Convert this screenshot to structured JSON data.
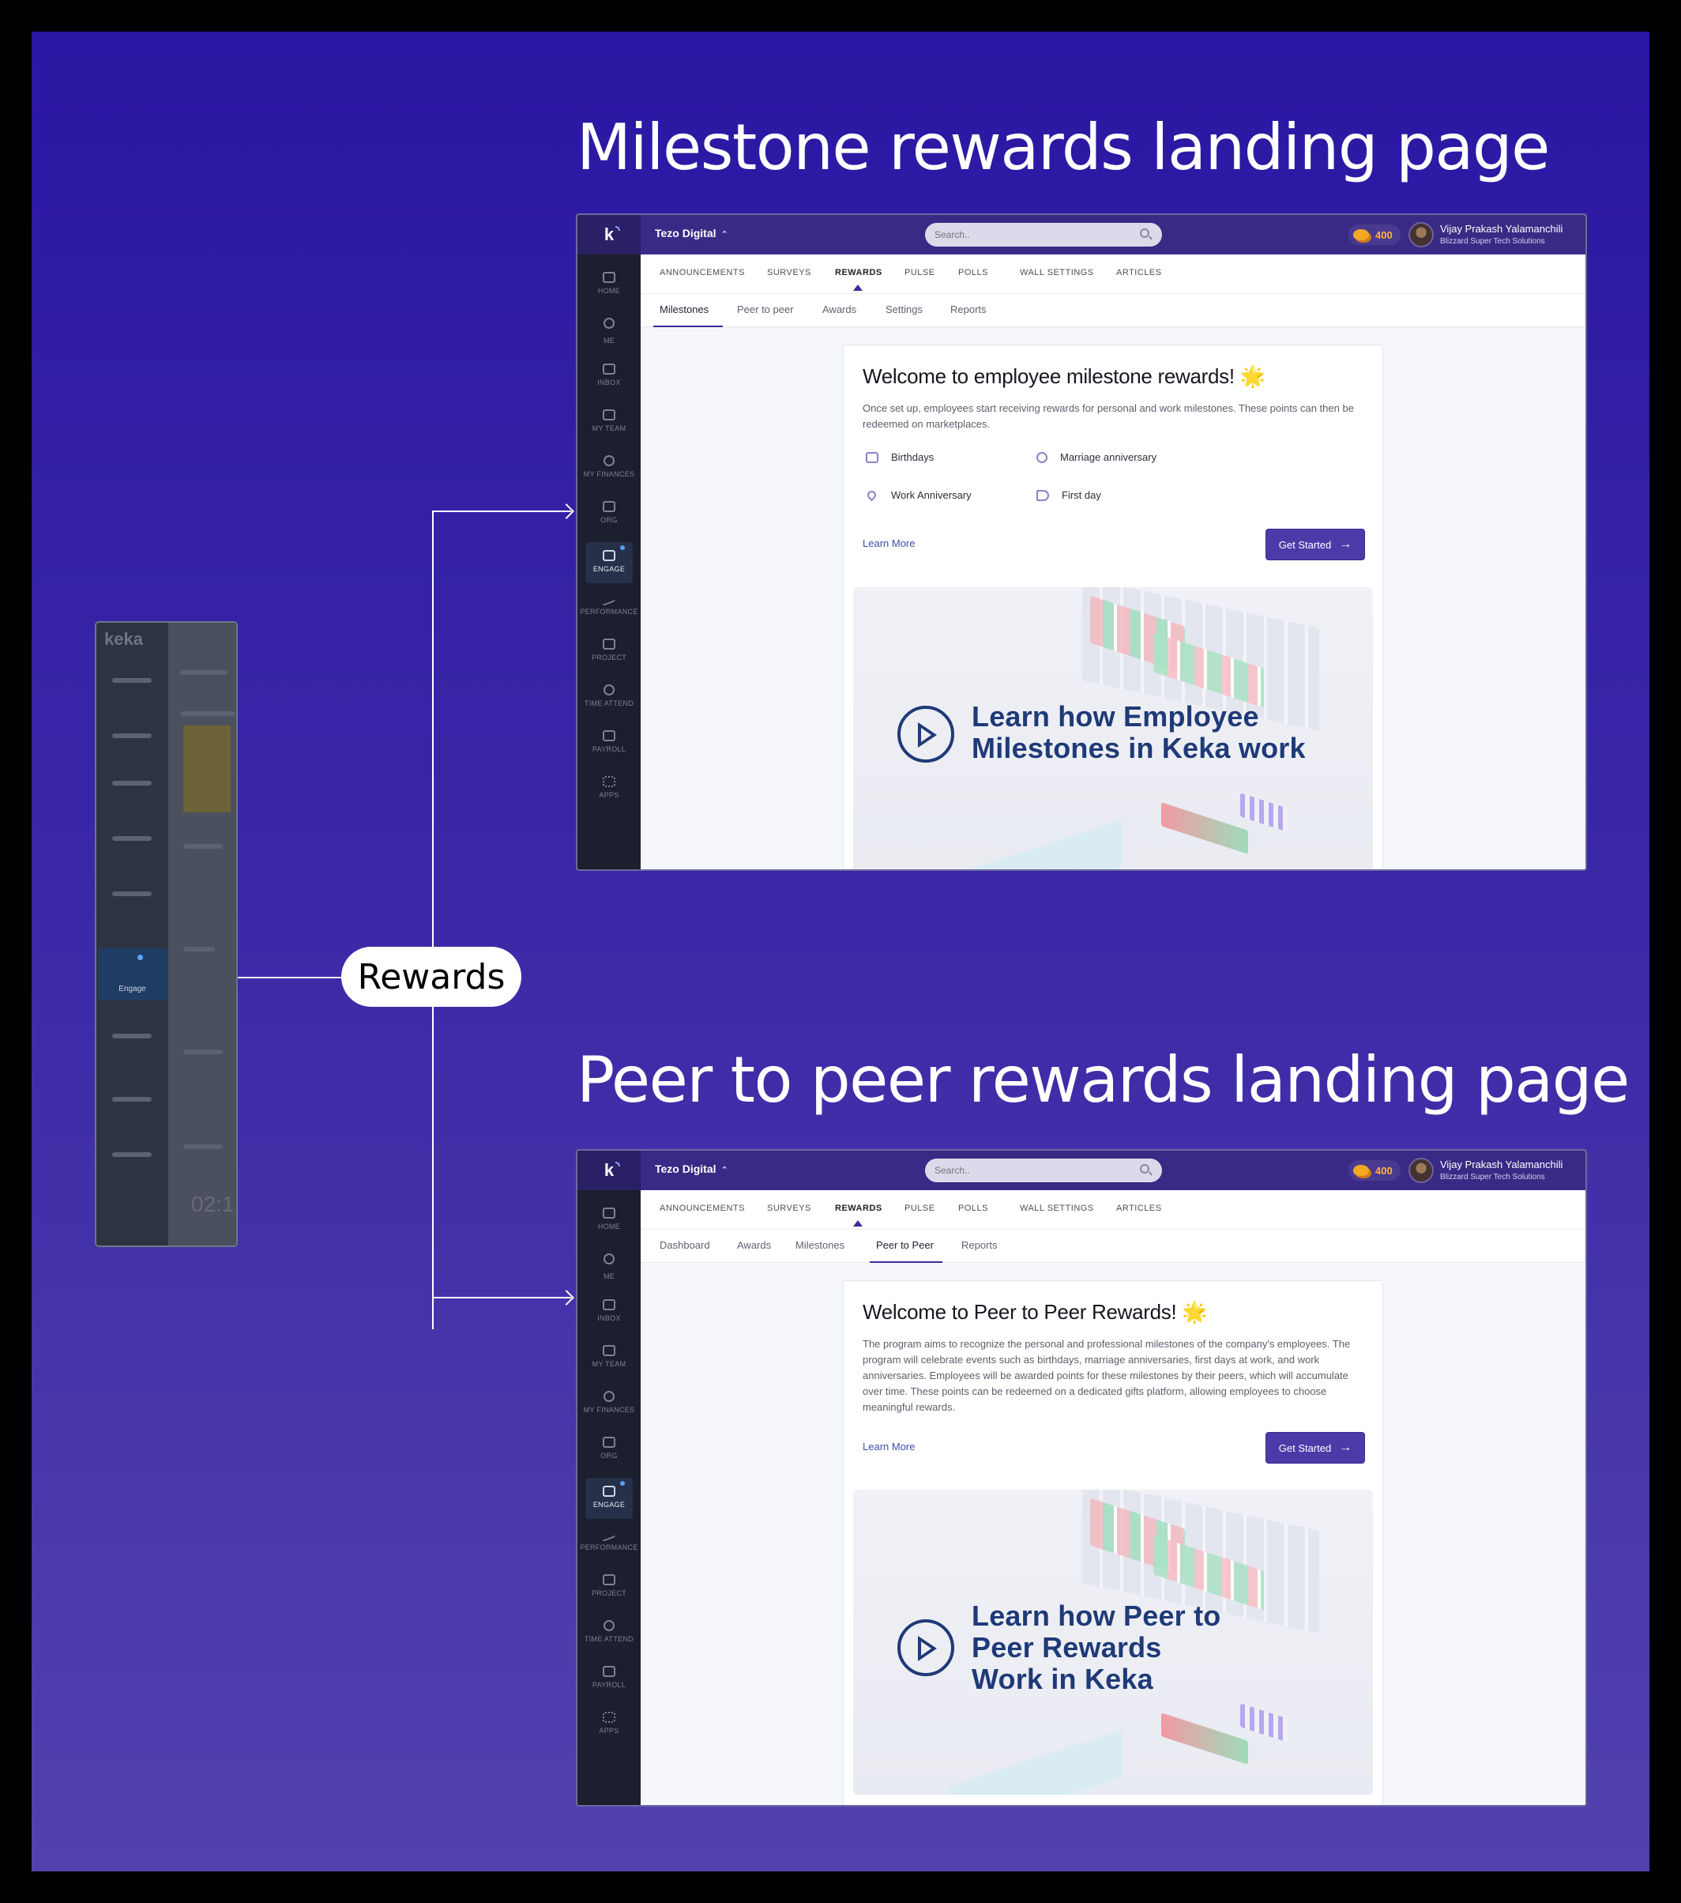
{
  "headings": {
    "milestone": "Milestone rewards landing page",
    "peer": "Peer to peer rewards landing page"
  },
  "pill_label": "Rewards",
  "thumb": {
    "logo": "keka",
    "engage_label": "Engage",
    "big_time": "02:1"
  },
  "app": {
    "org_name": "Tezo Digital",
    "search_placeholder": "Search..",
    "coins": "400",
    "user_name": "Vijay Prakash Yalamanchili",
    "user_company": "Blizzard Super Tech Solutions",
    "brand": "k",
    "sidebar": [
      "HOME",
      "ME",
      "INBOX",
      "MY TEAM",
      "MY FINANCES",
      "ORG",
      "ENGAGE",
      "PERFORMANCE",
      "PROJECT",
      "TIME ATTEND",
      "PAYROLL",
      "APPS"
    ],
    "main_tabs": [
      "ANNOUNCEMENTS",
      "SURVEYS",
      "REWARDS",
      "PULSE",
      "POLLS",
      "WALL SETTINGS",
      "ARTICLES"
    ]
  },
  "milestone": {
    "sub_tabs": [
      "Milestones",
      "Peer to peer",
      "Awards",
      "Settings",
      "Reports"
    ],
    "title": "Welcome to employee milestone rewards!",
    "star": "🌟",
    "desc": "Once set up, employees start receiving rewards for personal and work milestones. These points can then be redeemed on marketplaces.",
    "features": [
      "Birthdays",
      "Marriage anniversary",
      "Work Anniversary",
      "First day"
    ],
    "learn_more": "Learn More",
    "cta": "Get Started",
    "video_text": "Learn how Employee Milestones in Keka work"
  },
  "peer": {
    "sub_tabs": [
      "Dashboard",
      "Awards",
      "Milestones",
      "Peer to Peer",
      "Reports"
    ],
    "title": "Welcome to Peer to Peer Rewards!",
    "star": "🌟",
    "desc": "The program aims to recognize the personal and professional milestones of the company's employees. The program will celebrate events such as birthdays, marriage anniversaries, first days at work, and work anniversaries. Employees will be awarded points for these milestones by their peers, which will accumulate over time. These points can be redeemed on a dedicated gifts platform, allowing employees to choose meaningful rewards.",
    "learn_more": "Learn More",
    "cta": "Get Started",
    "video_text": "Learn how Peer to Peer Rewards Work in Keka"
  },
  "colors": {
    "brand": "#392a86",
    "accent": "#4c3aa8",
    "video_text": "#1f3a78"
  }
}
